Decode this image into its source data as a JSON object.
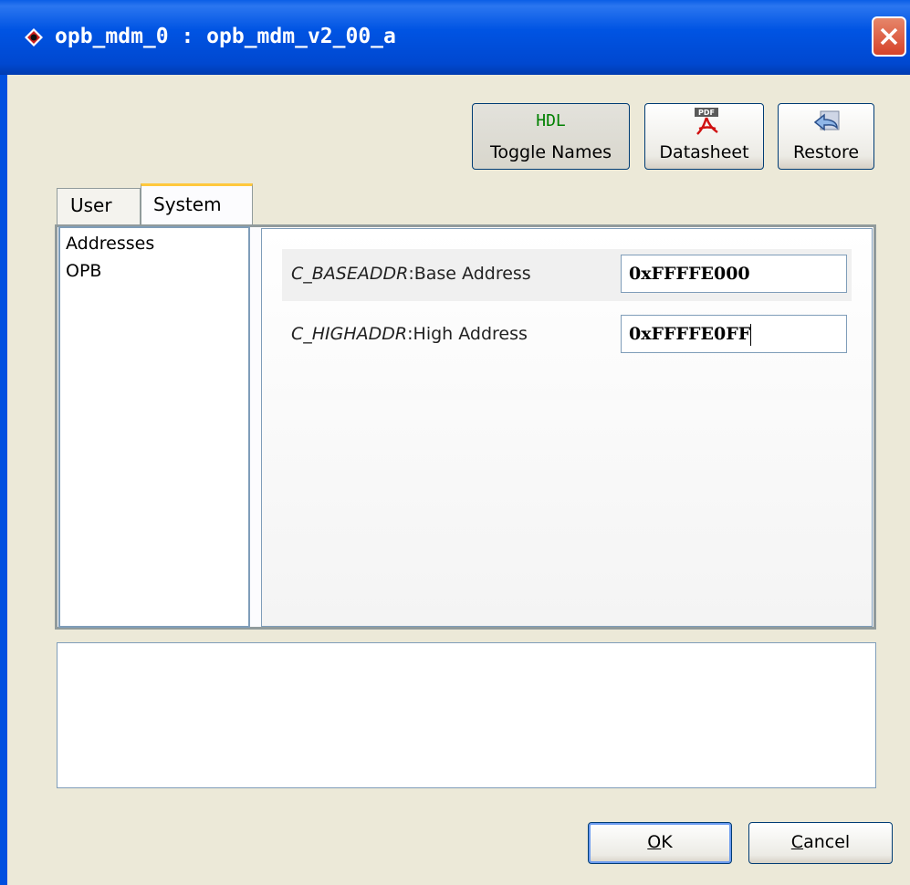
{
  "window": {
    "title": "opb_mdm_0 : opb_mdm_v2_00_a"
  },
  "toolbar": {
    "toggle_names": {
      "badge": "HDL",
      "label": "Toggle Names",
      "icon": "hdl-icon",
      "pressed": true
    },
    "datasheet": {
      "badge": "PDF",
      "label": "Datasheet",
      "icon": "pdf-icon"
    },
    "restore": {
      "label": "Restore",
      "icon": "restore-icon"
    }
  },
  "tabs": [
    {
      "label": "User",
      "active": false
    },
    {
      "label": "System",
      "active": true
    }
  ],
  "categories": [
    "Addresses",
    "OPB"
  ],
  "params": [
    {
      "hdl_name": "C_BASEADDR",
      "label": "Base Address",
      "value": "0xFFFFE000"
    },
    {
      "hdl_name": "C_HIGHADDR",
      "label": "High Address",
      "value": "0xFFFFE0FF"
    }
  ],
  "footer": {
    "ok": {
      "label": "OK",
      "mnemonic": "O",
      "rest": "K"
    },
    "cancel": {
      "label": "Cancel",
      "mnemonic": "C",
      "rest": "ancel"
    }
  },
  "colors": {
    "titlebar": "#0054e3",
    "tab_active_accent": "#ffc83c",
    "hdl_text": "#008000",
    "close": "#d6432a"
  }
}
